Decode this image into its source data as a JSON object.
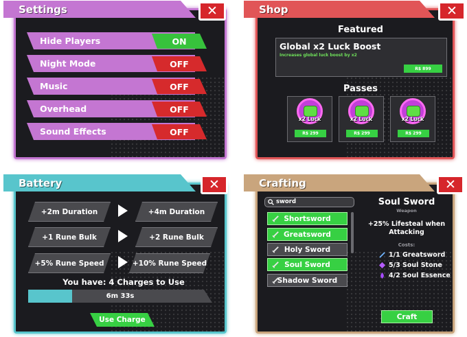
{
  "colors": {
    "settings_accent": "#c476d2",
    "shop_accent": "#e15557",
    "battery_accent": "#58c5cc",
    "crafting_accent": "#c9a57d",
    "button_green": "#37d043",
    "button_red": "#d62a2c",
    "panel_bg": "#1b1b1f"
  },
  "settings": {
    "title": "Settings",
    "close_label": "✕",
    "rows": [
      {
        "label": "Hide Players",
        "value": "ON"
      },
      {
        "label": "Night Mode",
        "value": "OFF"
      },
      {
        "label": "Music",
        "value": "OFF"
      },
      {
        "label": "Overhead",
        "value": "OFF"
      },
      {
        "label": "Sound Effects",
        "value": "OFF"
      }
    ]
  },
  "shop": {
    "title": "Shop",
    "close_label": "✕",
    "featured_heading": "Featured",
    "featured": {
      "name": "Global x2 Luck Boost",
      "description": "Increases global luck boost by x2",
      "price": "R$ 899"
    },
    "passes_heading": "Passes",
    "passes": [
      {
        "name": "x2 Luck",
        "price": "R$ 299",
        "icon": "luck-fist-icon"
      },
      {
        "name": "x2 Luck",
        "price": "R$ 299",
        "icon": "luck-fist-icon"
      },
      {
        "name": "x2 Luck",
        "price": "R$ 299",
        "icon": "luck-fist-icon"
      }
    ]
  },
  "battery": {
    "title": "Battery",
    "close_label": "✕",
    "upgrades": [
      {
        "current": "+2m Duration",
        "next": "+4m Duration"
      },
      {
        "current": "+1 Rune Bulk",
        "next": "+2 Rune Bulk"
      },
      {
        "current": "+5% Rune Speed",
        "next": "+10% Rune Speed"
      }
    ],
    "charges_text": "You have: 4 Charges to Use",
    "timer": "6m 33s",
    "timer_progress": 0.24,
    "use_button": "Use Charge"
  },
  "crafting": {
    "title": "Crafting",
    "close_label": "✕",
    "search_value": "sword",
    "search_icon": "search-icon",
    "items": [
      {
        "name": "Shortsword",
        "available": true
      },
      {
        "name": "Greatsword",
        "available": true
      },
      {
        "name": "Holy Sword",
        "available": false
      },
      {
        "name": "Soul Sword",
        "available": true
      },
      {
        "name": "Shadow Sword",
        "available": false
      }
    ],
    "selected": {
      "name": "Soul Sword",
      "type": "Weapon",
      "description": "+25% Lifesteal when Attacking",
      "costs_label": "Costs:",
      "costs": [
        {
          "text": "1/1 Greatsword",
          "icon": "sword-icon"
        },
        {
          "text": "5/3 Soul Stone",
          "icon": "soul-stone-icon"
        },
        {
          "text": "4/2 Soul Essence",
          "icon": "soul-essence-icon"
        }
      ]
    },
    "craft_button": "Craft"
  }
}
